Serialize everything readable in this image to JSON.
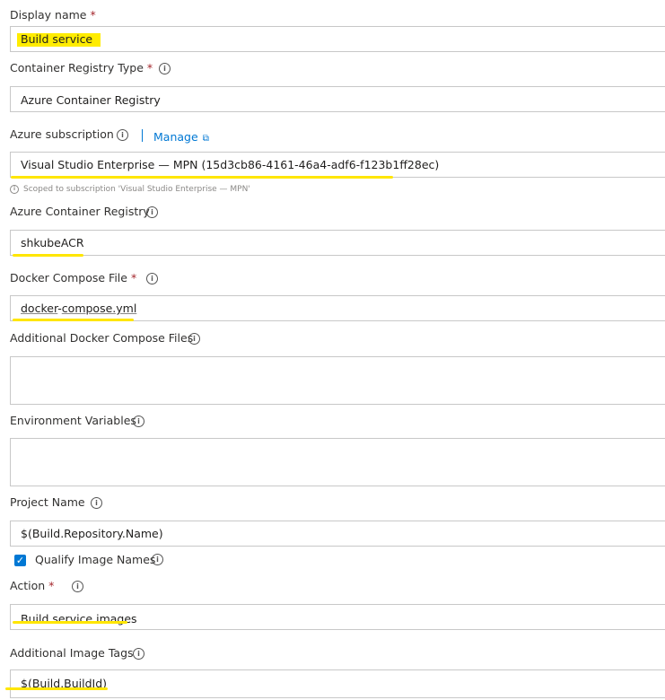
{
  "form": {
    "display_name": {
      "label": "Display name",
      "required_mark": "*",
      "value": "Build service"
    },
    "registry_type": {
      "label": "Container Registry Type",
      "required_mark": "*",
      "value": "Azure Container Registry"
    },
    "azure_subscription": {
      "label": "Azure subscription",
      "manage_link": "Manage",
      "value": "Visual Studio Enterprise — MPN (15d3cb86-4161-46a4-adf6-f123b1ff28ec)",
      "scope_note": "Scoped to subscription 'Visual Studio Enterprise — MPN'"
    },
    "azure_container_registry": {
      "label": "Azure Container Registry",
      "value": "shkubeACR"
    },
    "docker_compose_file": {
      "label": "Docker Compose File",
      "required_mark": "*",
      "value_part1": "docker",
      "value_part2": "-",
      "value_part3": "compose.yml"
    },
    "additional_compose_files": {
      "label": "Additional Docker Compose Files",
      "value": ""
    },
    "environment_variables": {
      "label": "Environment Variables",
      "value": ""
    },
    "project_name": {
      "label": "Project Name",
      "value": "$(Build.Repository.Name)"
    },
    "qualify_image_names": {
      "label": "Qualify Image Names",
      "checked": true,
      "check_glyph": "✓"
    },
    "action": {
      "label": "Action",
      "required_mark": "*",
      "value": "Build service images"
    },
    "additional_image_tags": {
      "label": "Additional Image Tags",
      "value": "$(Build.BuildId)"
    }
  },
  "icons": {
    "info": "i",
    "external_link": "⧉",
    "note_info": "i"
  },
  "colors": {
    "highlight": "#ffe600",
    "accent": "#0078d4",
    "required": "#a4262c",
    "border": "#c8c8c8"
  }
}
